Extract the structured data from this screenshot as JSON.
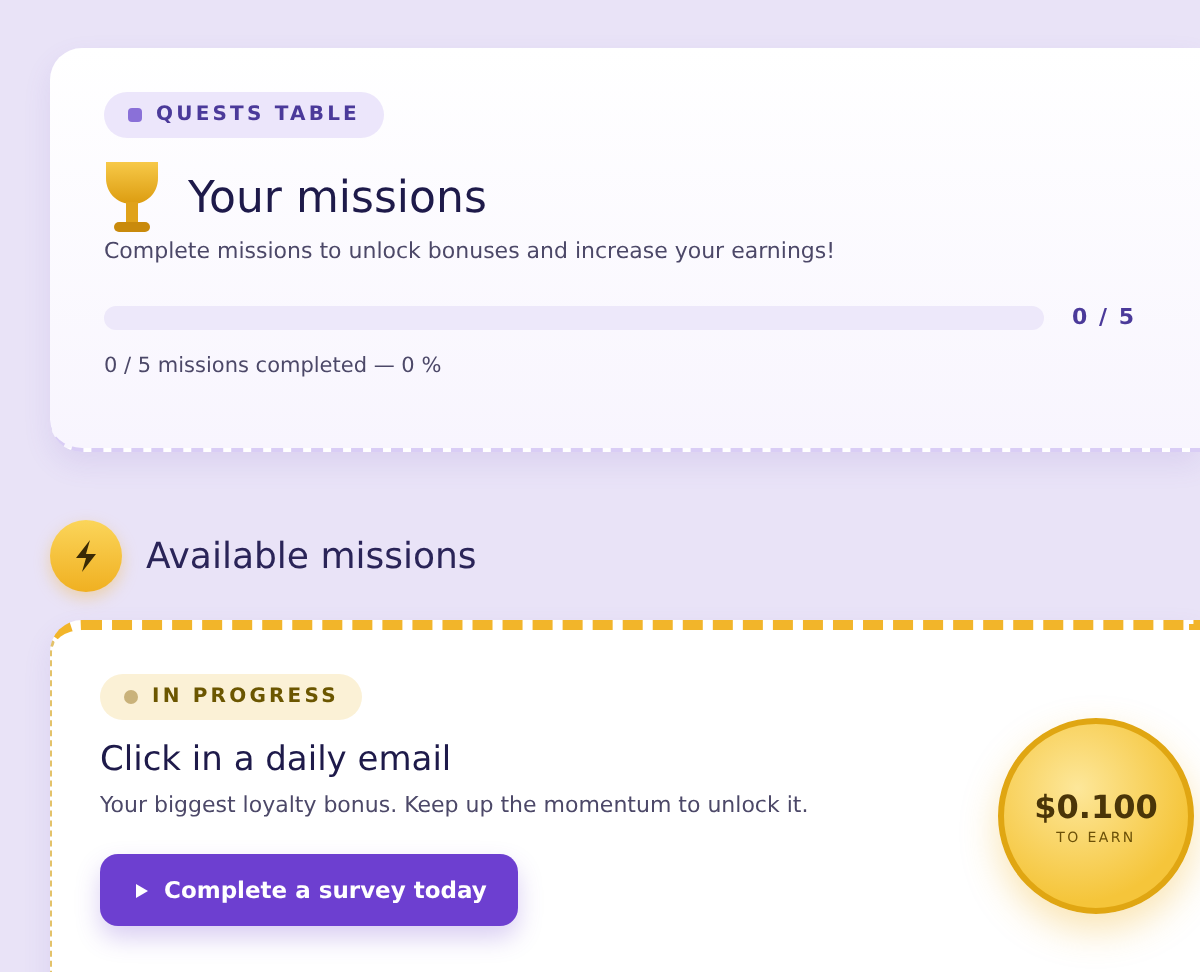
{
  "header": {
    "badge": "QUESTS TABLE",
    "title": "Your missions",
    "subtitle": "Complete missions to unlock bonuses and increase your earnings!",
    "progress": {
      "level": 0,
      "count": "0 / 5",
      "summary": "0 / 5 missions completed — 0 %"
    }
  },
  "section": {
    "title": "Available missions"
  },
  "missions": [
    {
      "status": "IN PROGRESS",
      "title": "Click in a daily email",
      "description": "Your biggest loyalty bonus. Keep up the momentum to unlock it.",
      "button": "Complete a survey today",
      "reward": "$0.100",
      "reward_label": "TO EARN"
    }
  ]
}
